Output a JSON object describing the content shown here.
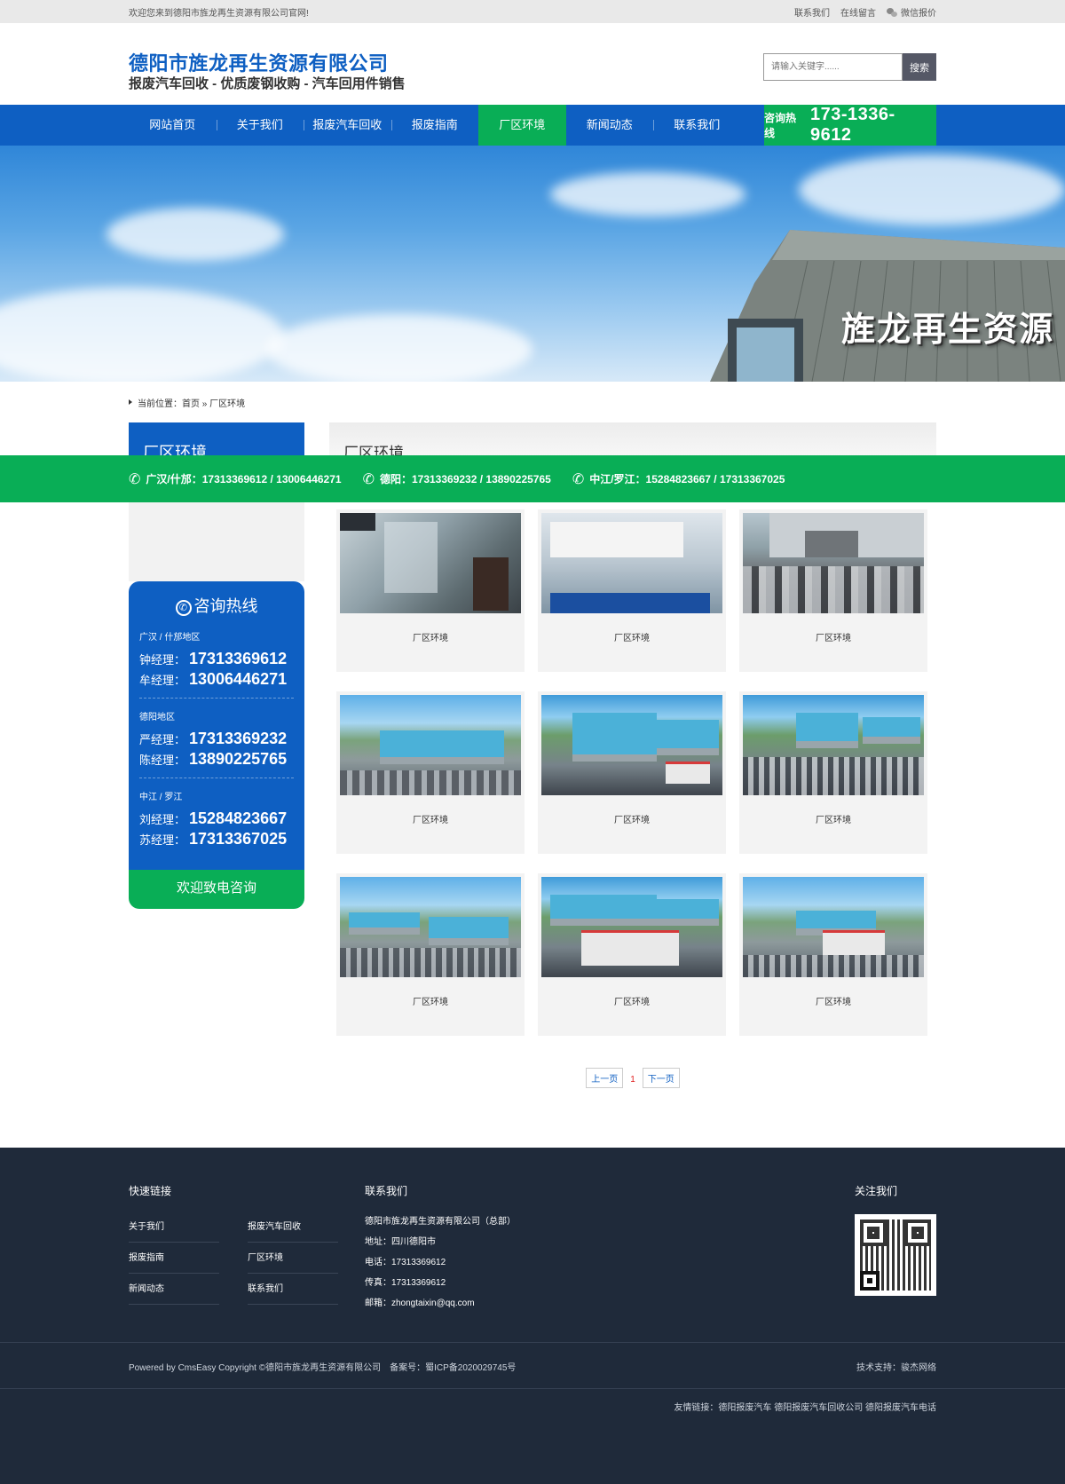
{
  "topbar": {
    "welcome": "欢迎您来到德阳市旌龙再生资源有限公司官网!",
    "links": [
      "联系我们",
      "在线留言",
      "微信报价"
    ]
  },
  "header": {
    "company": "德阳市旌龙再生资源有限公司",
    "slogan": "报废汽车回收 - 优质废钢收购 - 汽车回用件销售",
    "search_placeholder": "请输入关键字......",
    "search_button": "搜索"
  },
  "nav": {
    "items": [
      "网站首页",
      "关于我们",
      "报废汽车回收",
      "报废指南",
      "厂区环境",
      "新闻动态",
      "联系我们"
    ],
    "active": "厂区环境",
    "hotline_label": "咨询热线",
    "hotline_number": "173-1336-9612"
  },
  "banner": {
    "text": "旌龙再生资源"
  },
  "breadcrumb": {
    "text": "当前位置：首页 » 厂区环境"
  },
  "sidebar": {
    "title": "厂区环境",
    "contact_title": "咨询热线",
    "regions": [
      {
        "name": "广汉 / 什邡地区",
        "contacts": [
          {
            "name": "钟经理：",
            "phone": "17313369612"
          },
          {
            "name": "牟经理：",
            "phone": "13006446271"
          }
        ]
      },
      {
        "name": "德阳地区",
        "contacts": [
          {
            "name": "严经理：",
            "phone": "17313369232"
          },
          {
            "name": "陈经理：",
            "phone": "13890225765"
          }
        ]
      },
      {
        "name": "中江 / 罗江",
        "contacts": [
          {
            "name": "刘经理：",
            "phone": "15284823667"
          },
          {
            "name": "苏经理：",
            "phone": "17313367025"
          }
        ]
      }
    ],
    "contact_footer": "欢迎致电咨询"
  },
  "content": {
    "title": "厂区环境",
    "captions": [
      "厂区环境",
      "厂区环境",
      "厂区环境",
      "厂区环境",
      "厂区环境",
      "厂区环境",
      "厂区环境",
      "厂区环境",
      "厂区环境"
    ]
  },
  "pager": {
    "prev": "上一页",
    "current": "1",
    "next": "下一页"
  },
  "float_bar": {
    "items": [
      "广汉/什邡：17313369612 / 13006446271",
      "德阳：17313369232 / 13890225765",
      "中江/罗江：15284823667 / 17313367025"
    ]
  },
  "footer": {
    "quick_title": "快速链接",
    "quick_links": [
      "关于我们",
      "报废汽车回收",
      "报废指南",
      "厂区环境",
      "新闻动态",
      "联系我们"
    ],
    "contact_title": "联系我们",
    "contact_lines": [
      "德阳市旌龙再生资源有限公司（总部）",
      "地址：四川德阳市",
      "电话：17313369612",
      "传真：17313369612",
      "邮箱：zhongtaixin@qq.com"
    ],
    "follow_title": "关注我们",
    "copyright": "Powered by CmsEasy Copyright ©德阳市旌龙再生资源有限公司　备案号：蜀ICP备2020029745号",
    "tech_support": "技术支持：骏杰网络",
    "friend_links": "友情链接：德阳报废汽车 德阳报废汽车回收公司 德阳报废汽车电话"
  }
}
